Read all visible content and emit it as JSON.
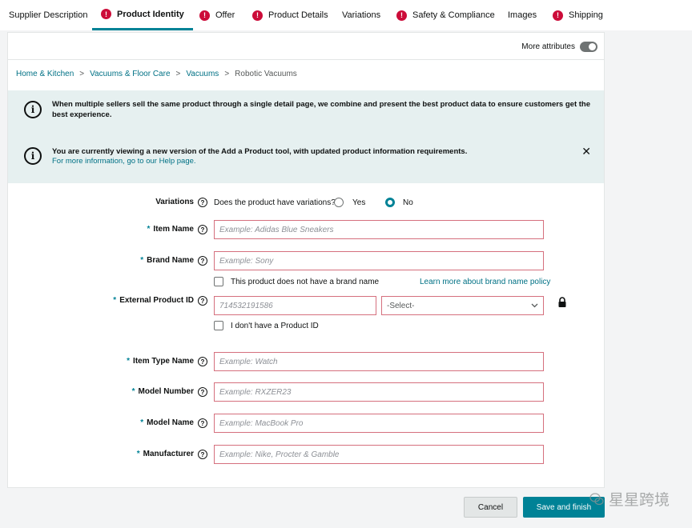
{
  "tabs": [
    {
      "label": "Supplier Description",
      "error": false,
      "active": false
    },
    {
      "label": "Product Identity",
      "error": true,
      "active": true
    },
    {
      "label": "Offer",
      "error": true,
      "active": false
    },
    {
      "label": "Product Details",
      "error": true,
      "active": false
    },
    {
      "label": "Variations",
      "error": false,
      "active": false
    },
    {
      "label": "Safety & Compliance",
      "error": true,
      "active": false
    },
    {
      "label": "Images",
      "error": false,
      "active": false
    },
    {
      "label": "Shipping",
      "error": true,
      "active": false
    }
  ],
  "error_glyph": "!",
  "more_attributes": {
    "label": "More attributes",
    "enabled": false
  },
  "breadcrumb": {
    "items": [
      "Home & Kitchen",
      "Vacuums & Floor Care",
      "Vacuums",
      "Robotic Vacuums"
    ],
    "separator": ">"
  },
  "alerts": {
    "icon_glyph": "i",
    "info": {
      "text": "When multiple sellers sell the same product through a single detail page, we combine and present the best product data to ensure customers get the best experience."
    },
    "version": {
      "text": "You are currently viewing a new version of the Add a Product tool, with updated product information requirements.",
      "link": "For more information, go to our Help page.",
      "close": "✕"
    }
  },
  "help_glyph": "?",
  "required_mark": "*",
  "form": {
    "variations": {
      "label": "Variations",
      "question": "Does the product have variations?",
      "options": [
        "Yes",
        "No"
      ],
      "selected": "No"
    },
    "item_name": {
      "label": "Item Name",
      "placeholder": "Example: Adidas Blue Sneakers"
    },
    "brand_name": {
      "label": "Brand Name",
      "placeholder": "Example: Sony",
      "no_brand_label": "This product does not have a brand name",
      "policy_link": "Learn more about brand name policy"
    },
    "external_product_id": {
      "label": "External Product ID",
      "placeholder": "714532191586",
      "select_value": "-Select-",
      "no_id_label": "I don't have a Product ID"
    },
    "item_type_name": {
      "label": "Item Type Name",
      "placeholder": "Example: Watch"
    },
    "model_number": {
      "label": "Model Number",
      "placeholder": "Example: RXZER23"
    },
    "model_name": {
      "label": "Model Name",
      "placeholder": "Example: MacBook Pro"
    },
    "manufacturer": {
      "label": "Manufacturer",
      "placeholder": "Example: Nike, Procter & Gamble"
    }
  },
  "footer": {
    "cancel_label": "Cancel",
    "save_label": "Save and finish"
  },
  "watermark": {
    "text": "星星跨境"
  },
  "colors": {
    "accent": "#008296",
    "error": "#cc0c39",
    "link": "#007185",
    "alert_bg": "#e6f0f0",
    "invalid_border": "#d5707e"
  }
}
